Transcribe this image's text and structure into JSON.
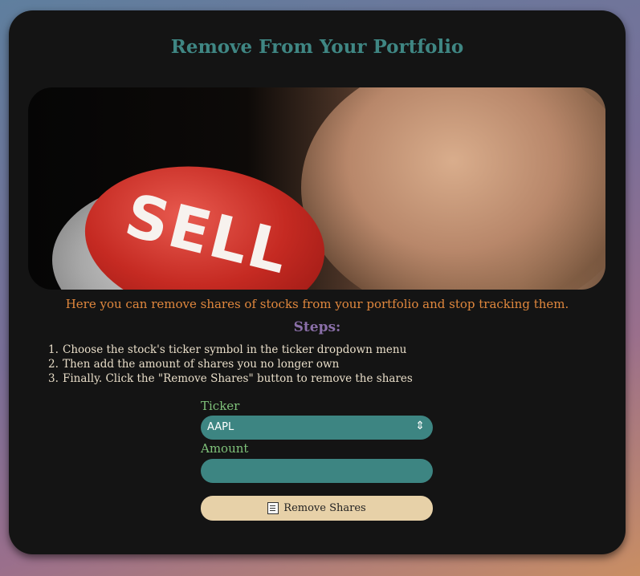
{
  "page": {
    "title": "Remove From Your Portfolio",
    "intro": "Here you can remove shares of stocks from your portfolio and stop tracking them.",
    "steps_title": "Steps:",
    "steps": [
      {
        "num": "1.",
        "text": "Choose the stock's ticker symbol in the ticker dropdown menu"
      },
      {
        "num": "2.",
        "text": "Then add the amount of shares you no longer own"
      },
      {
        "num": "3.",
        "text": "Finally. Click the \"Remove Shares\" button to remove the shares"
      }
    ],
    "hero_image_text": "SELL"
  },
  "form": {
    "ticker_label": "Ticker",
    "ticker_value": "AAPL",
    "ticker_arrow_icon": "select-arrows-icon",
    "amount_label": "Amount",
    "amount_value": "",
    "submit_label": "Remove Shares",
    "submit_icon": "memo-icon"
  },
  "colors": {
    "title": "#3f8683",
    "intro": "#e0873d",
    "steps_title": "#8a6fa8",
    "labels": "#7fc27a",
    "inputs": "#3d8582",
    "button": "#e7d1a8",
    "card": "#141414"
  }
}
